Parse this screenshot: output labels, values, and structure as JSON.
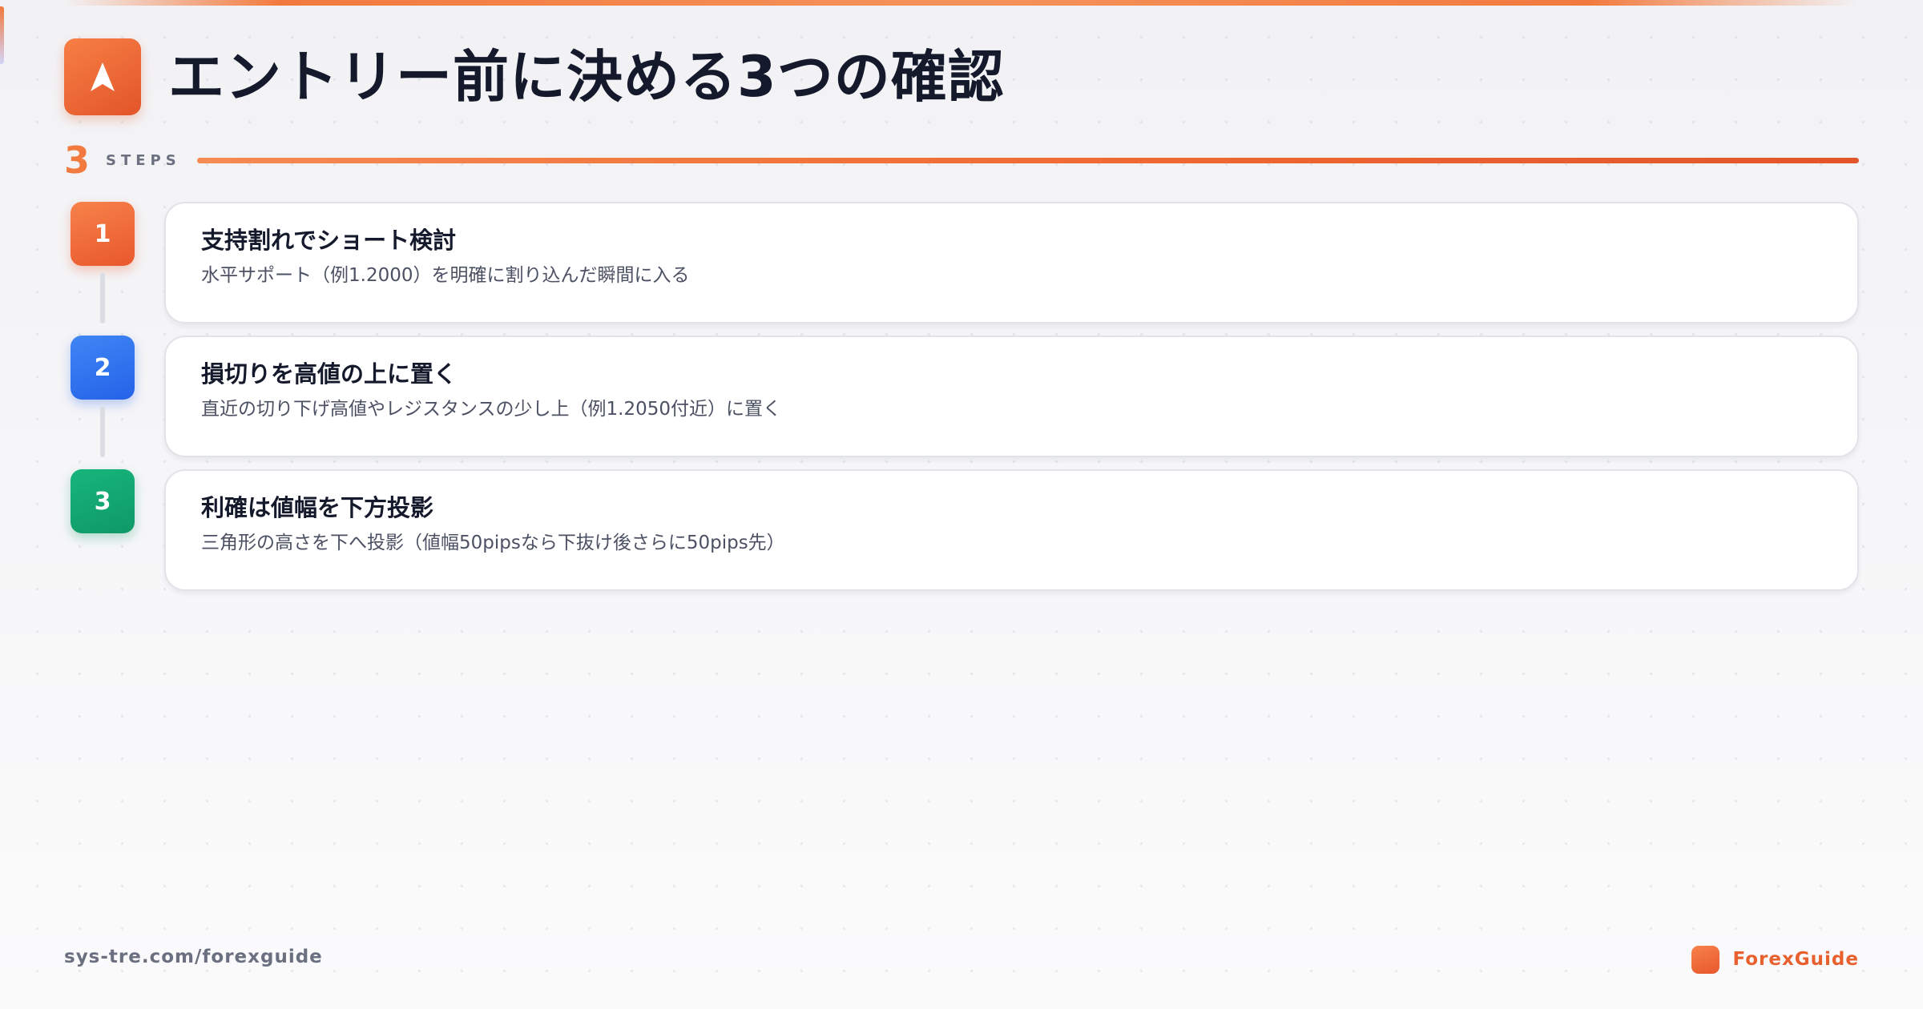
{
  "header": {
    "title": "エントリー前に決める3つの確認",
    "logo_icon": "navigation-arrow-icon"
  },
  "steps_bar": {
    "count": "3",
    "label": "STEPS"
  },
  "steps": [
    {
      "number": "1",
      "title": "支持割れでショート検討",
      "description": "水平サポート（例1.2000）を明確に割り込んだ瞬間に入る",
      "color": "#ef6a34"
    },
    {
      "number": "2",
      "title": "損切りを高値の上に置く",
      "description": "直近の切り下げ高値やレジスタンスの少し上（例1.2050付近）に置く",
      "color": "#2f6ff0"
    },
    {
      "number": "3",
      "title": "利確は値幅を下方投影",
      "description": "三角形の高さを下へ投影（値幅50pipsなら下抜け後さらに50pips先）",
      "color": "#12a570"
    }
  ],
  "footer": {
    "url": "sys-tre.com/forexguide",
    "brand": "ForexGuide",
    "brand_color": "#e8602e"
  },
  "colors": {
    "accent": "#f27a3e",
    "text": "#141a2b"
  }
}
